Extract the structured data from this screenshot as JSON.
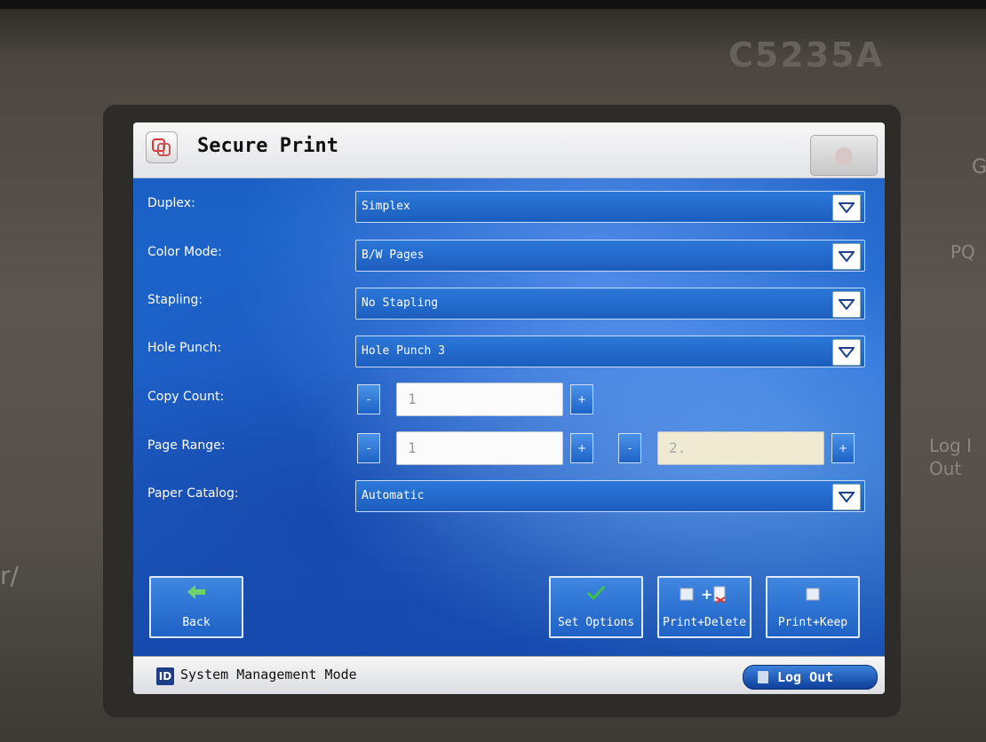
{
  "device": {
    "model": "C5235A",
    "edge_right_top": "G",
    "edge_right_mid": "PQ",
    "edge_right_log": "Log I",
    "edge_right_out": "Out",
    "edge_left": "r/"
  },
  "window": {
    "title": "Secure Print",
    "icon": "secure-print-icon"
  },
  "settings": {
    "duplex": {
      "label": "Duplex:",
      "value": "Simplex"
    },
    "color_mode": {
      "label": "Color Mode:",
      "value": "B/W Pages"
    },
    "stapling": {
      "label": "Stapling:",
      "value": "No Stapling"
    },
    "hole_punch": {
      "label": "Hole Punch:",
      "value": "Hole Punch 3"
    },
    "copy_count": {
      "label": "Copy Count:",
      "value": "1",
      "minus": "-",
      "plus": "+"
    },
    "page_range": {
      "label": "Page Range:",
      "from": "1",
      "to": "2.",
      "minus": "-",
      "plus": "+"
    },
    "paper_catalog": {
      "label": "Paper Catalog:",
      "value": "Automatic"
    }
  },
  "actions": {
    "back": "Back",
    "set_options": "Set Options",
    "print_delete": "Print+Delete",
    "print_keep": "Print+Keep",
    "plus_sign": "+"
  },
  "status": {
    "id_badge": "ID",
    "mode": "System Management Mode",
    "logout": "Log Out"
  },
  "colors": {
    "screen_blue": "#1f6ad2",
    "check_green": "#3fc14a",
    "back_arrow_green": "#6fd36a"
  }
}
